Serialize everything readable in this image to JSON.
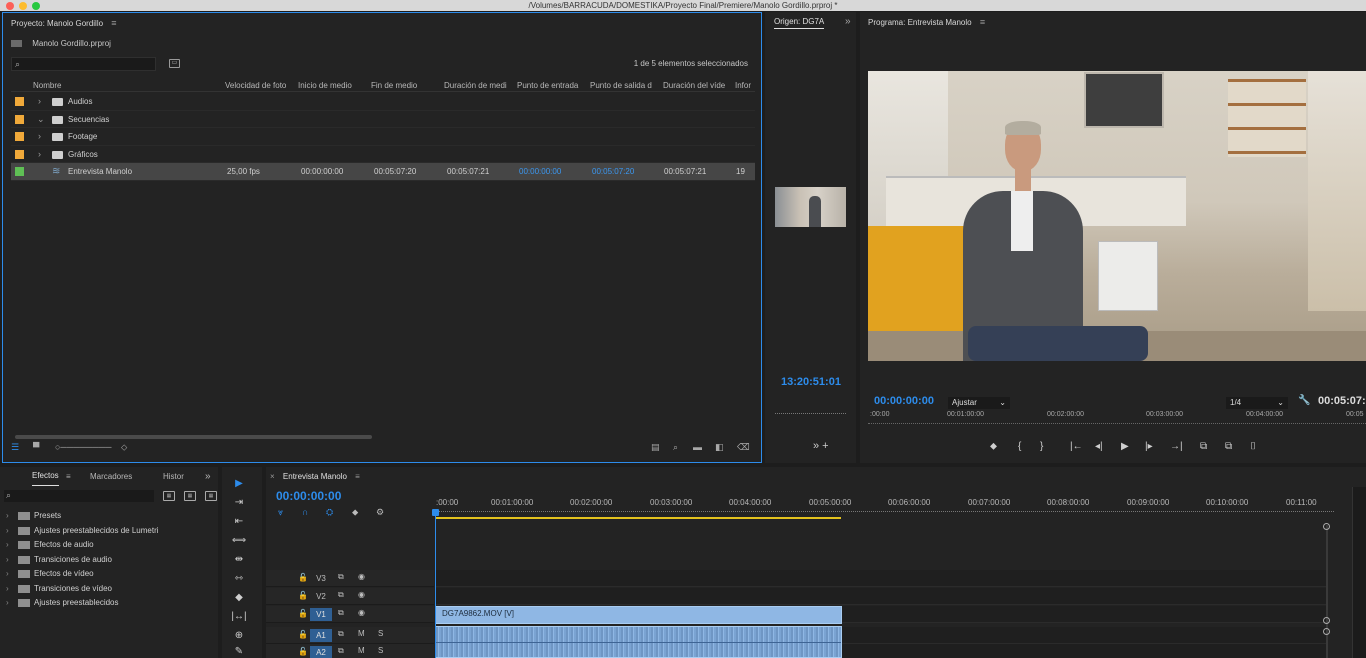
{
  "window": {
    "path": "/Volumes/BARRACUDA/DOMESTIKA/Proyecto Final/Premiere/Manolo Gordillo.prproj *"
  },
  "project": {
    "title": "Proyecto: Manolo Gordillo",
    "menu": "≡",
    "file": "Manolo Gordillo.prproj",
    "search_glyph": "⌕",
    "selection": "1 de 5 elementos seleccionados",
    "columns": [
      "Nombre",
      "Velocidad de foto",
      "Inicio de medio",
      "Fin de medio",
      "Duración de medi",
      "Punto de entrada",
      "Punto de salida d",
      "Duración del víde",
      "Infor"
    ],
    "items": [
      {
        "label_color": "#f0a93a",
        "name": "Audios",
        "type": "folder",
        "expanded": false
      },
      {
        "label_color": "#f0a93a",
        "name": "Secuencias",
        "type": "folder",
        "expanded": true
      },
      {
        "label_color": "#f0a93a",
        "name": "Footage",
        "type": "folder",
        "expanded": false
      },
      {
        "label_color": "#f0a93a",
        "name": "Gráficos",
        "type": "folder",
        "expanded": false
      },
      {
        "label_color": "#5fbf55",
        "name": "Entrevista Manolo",
        "type": "sequence",
        "fps": "25,00 fps",
        "media_start": "00:00:00:00",
        "media_end": "00:05:07:20",
        "media_duration": "00:05:07:21",
        "in_point": "00:00:00:00",
        "out_point": "00:05:07:20",
        "video_duration": "00:05:07:21",
        "info": "19"
      }
    ]
  },
  "source": {
    "tab": "Origen: DG7A",
    "more": "»",
    "timecode": "13:20:51:01",
    "bottom_glyph": "» +"
  },
  "program": {
    "title": "Programa: Entrevista Manolo",
    "menu": "≡",
    "timecode": "00:00:00:00",
    "fit": "Ajustar",
    "quality": "1/4",
    "duration": "00:05:07:",
    "ruler": [
      ":00:00",
      "00:01:00:00",
      "00:02:00:00",
      "00:03:00:00",
      "00:04:00:00",
      "00:05"
    ],
    "transport": [
      "⬥",
      "{",
      "}",
      "|←",
      "◂|",
      "▶",
      "|▸",
      "→|",
      "⧉",
      "⧉",
      "⌷"
    ]
  },
  "effects": {
    "tabs": [
      "Efectos",
      "Marcadores",
      "Histor"
    ],
    "menu": "≡",
    "more": "»",
    "search_glyph": "⌕",
    "items": [
      "Presets",
      "Ajustes preestablecidos de Lumetri",
      "Efectos de audio",
      "Transiciones de audio",
      "Efectos de vídeo",
      "Transiciones de vídeo",
      "Ajustes preestablecidos"
    ]
  },
  "tools": [
    "▶",
    "⇥",
    "⇤",
    "⟺",
    "⇹",
    "⇿",
    "◆",
    "|↔|",
    "⊕",
    "✎"
  ],
  "timeline": {
    "tab": "Entrevista Manolo",
    "close": "×",
    "menu": "≡",
    "timecode": "00:00:00:00",
    "tool_glyphs": [
      "⩔",
      "∩",
      "⛭",
      "⬥",
      "⚙"
    ],
    "ruler": [
      ":00:00",
      "00:01:00:00",
      "00:02:00:00",
      "00:03:00:00",
      "00:04:00:00",
      "00:05:00:00",
      "00:06:00:00",
      "00:07:00:00",
      "00:08:00:00",
      "00:09:00:00",
      "00:10:00:00",
      "00:11:00"
    ],
    "tracks": [
      {
        "name": "V3",
        "targeted": false,
        "kind": "video"
      },
      {
        "name": "V2",
        "targeted": false,
        "kind": "video"
      },
      {
        "name": "V1",
        "targeted": true,
        "kind": "video"
      },
      {
        "name": "A1",
        "targeted": true,
        "kind": "audio"
      },
      {
        "name": "A2",
        "targeted": true,
        "kind": "audio"
      }
    ],
    "clip_video": "DG7A9862.MOV [V]"
  }
}
